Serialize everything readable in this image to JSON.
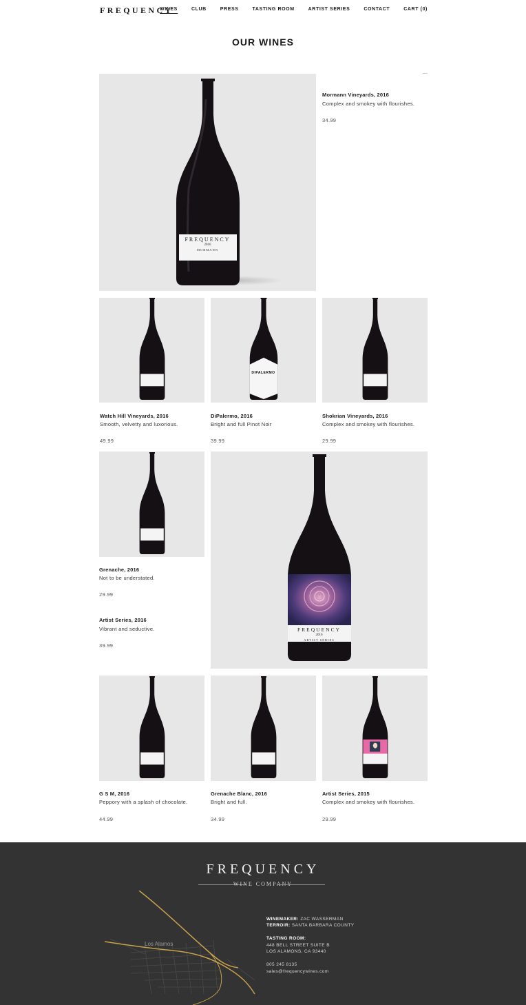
{
  "header": {
    "logo": "FREQUENCY",
    "nav": [
      "WINES",
      "CLUB",
      "PRESS",
      "TASTING ROOM",
      "ARTIST SERIES",
      "CONTACT",
      "CART (0)"
    ]
  },
  "page_title": "OUR WINES",
  "products": [
    {
      "name": "Mormann Vineyards, 2016",
      "desc": "Complex and smokey with flourishes.",
      "price": "34.99",
      "label": "FREQUENCY",
      "label_year": "2016",
      "label_sub": "MORMANN"
    },
    {
      "name": "Watch Hill Vineyards, 2016",
      "desc": "Smooth, velvetty and luxorious.",
      "price": "49.99"
    },
    {
      "name": "DiPalermo, 2016",
      "desc": "Bright and full Pinot Noir",
      "price": "39.99",
      "label": "DIPALERMO"
    },
    {
      "name": "Shokrian Vineyards, 2016",
      "desc": "Complex and smokey with flourishes.",
      "price": "29.99"
    },
    {
      "name": "Grenache, 2016",
      "desc": "Not to be understated.",
      "price": "29.99"
    },
    {
      "name": "Artist Series, 2016",
      "desc": "Vibrant and seductive.",
      "price": "39.99",
      "label": "FREQUENCY",
      "label_year": "2016",
      "label_sub": "ARTIST SERIES"
    },
    {
      "name": "G S M, 2016",
      "desc": "Peppory with a splash of chocolate.",
      "price": "44.99"
    },
    {
      "name": "Grenache Blanc, 2016",
      "desc": "Bright and full.",
      "price": "34.99"
    },
    {
      "name": "Artist Series, 2015",
      "desc": "Complex and smokey with flourishes.",
      "price": "29.99"
    }
  ],
  "footer": {
    "logo": "FREQUENCY",
    "sub": "WINE COMPANY",
    "winemaker_label": "WINEMAKER:",
    "winemaker": "ZAC WASSERMAN",
    "terroir_label": "TERROIR:",
    "terroir": "SANTA BARBARA COUNTY",
    "tasting_label": "TASTING ROOM:",
    "address1": "448 BELL STREET SUITE B",
    "address2": "LOS ALAMONS, CA 93440",
    "phone": "805 245 8135",
    "email": "sales@frequencywines.com",
    "map_town": "Los Alamos"
  },
  "colors": {
    "footer_bg": "#333333",
    "tile_bg": "#e7e7e7",
    "bottle": "#141014",
    "map_road": "#c9a24a"
  }
}
